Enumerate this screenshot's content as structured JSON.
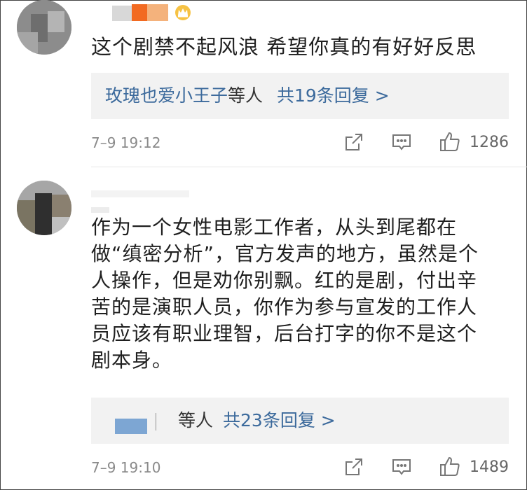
{
  "comments": [
    {
      "text": "这个剧禁不起风浪 希望你真的有好好反思",
      "reply_first_user": "玫瑰也爱小王子",
      "reply_etc": "等人",
      "reply_count_text": "共19条回复 >",
      "time": "7–9 19:12",
      "likes": "1286"
    },
    {
      "text": "作为一个女性电影工作者，从头到尾都在做“缜密分析”，官方发声的地方，虽然是个人操作，但是劝你别飘。红的是剧，付出辛苦的是演职人员，你作为参与宣发的工作人员应该有职业理智，后台打字的你不是这个剧本身。",
      "reply_etc": "等人",
      "reply_count_text": "共23条回复 >",
      "time": "7–9 19:10",
      "likes": "1489"
    }
  ],
  "icons": {
    "share": "share-icon",
    "comment": "comment-icon",
    "like": "thumbs-up-icon",
    "vip": "crown-icon"
  },
  "colors": {
    "link": "#3c6a9c",
    "meta": "#8a8a8a",
    "reply_bg": "#f2f2f2",
    "crown": "#f0a020"
  }
}
